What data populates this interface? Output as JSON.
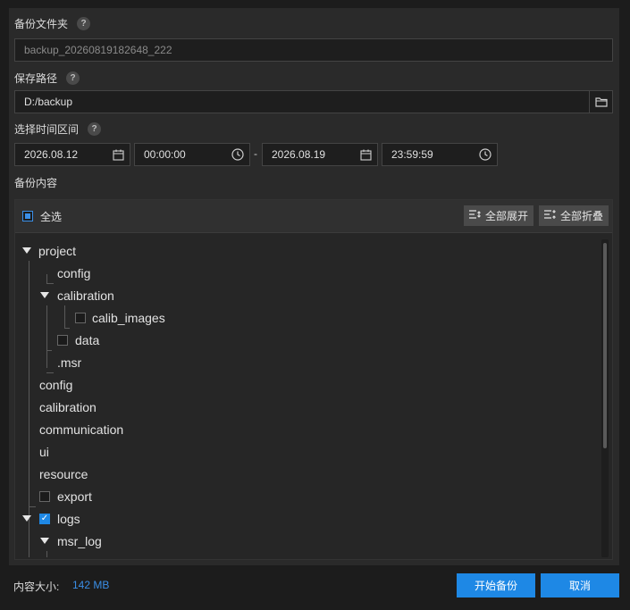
{
  "backup_folder": {
    "label": "备份文件夹",
    "help": "?",
    "value": "backup_20260819182648_222"
  },
  "save_path": {
    "label": "保存路径",
    "help": "?",
    "value": "D:/backup",
    "folder_icon": "folder-icon"
  },
  "time_range": {
    "label": "选择时间区间",
    "help": "?",
    "start_date": "2026.08.12",
    "start_time": "00:00:00",
    "separator": "-",
    "end_date": "2026.08.19",
    "end_time": "23:59:59"
  },
  "content": {
    "label": "备份内容",
    "select_all": "全选",
    "expand_all": "全部展开",
    "collapse_all": "全部折叠",
    "tree": [
      {
        "label": "project",
        "expanded": true
      },
      {
        "label": "config"
      },
      {
        "label": "calibration",
        "expanded": true
      },
      {
        "label": "calib_images",
        "checked": false
      },
      {
        "label": "data",
        "checked": false
      },
      {
        "label": ".msr"
      },
      {
        "label": "config"
      },
      {
        "label": "calibration"
      },
      {
        "label": "communication"
      },
      {
        "label": "ui"
      },
      {
        "label": "resource"
      },
      {
        "label": "export",
        "checked": false
      },
      {
        "label": "logs",
        "expanded": true,
        "checked": true
      },
      {
        "label": "msr_log",
        "expanded": true
      }
    ]
  },
  "footer": {
    "size_label": "内容大小:",
    "size_value": "142 MB",
    "start_button": "开始备份",
    "cancel_button": "取消"
  },
  "colors": {
    "accent": "#1e88e5",
    "background": "#1c1c1c",
    "panel": "#2a2a2a"
  }
}
